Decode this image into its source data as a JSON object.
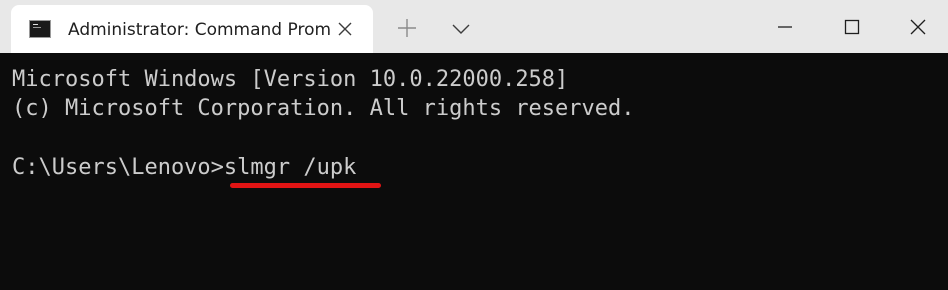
{
  "tab": {
    "title": "Administrator: Command Prompt"
  },
  "icons": {
    "tab_icon": "cmd-icon",
    "close_tab": "close-icon",
    "new_tab": "plus-icon",
    "dropdown": "chevron-down-icon",
    "minimize": "minimize-icon",
    "maximize": "maximize-icon",
    "close_window": "close-icon"
  },
  "console": {
    "line1": "Microsoft Windows [Version 10.0.22000.258]",
    "line2": "(c) Microsoft Corporation. All rights reserved.",
    "prompt": "C:\\Users\\Lenovo>",
    "command": "slmgr /upk"
  },
  "colors": {
    "titlebar": "#e8e8e8",
    "tab": "#ffffff",
    "console_bg": "#0c0c0c",
    "console_text": "#cccccc",
    "annotation": "#e11414"
  }
}
